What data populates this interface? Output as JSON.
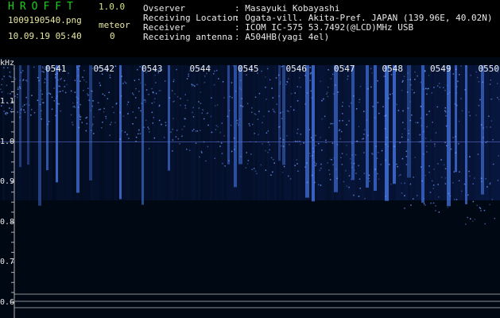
{
  "header": {
    "app_title": "HROFFT",
    "app_version": "1.0.0",
    "file_name": "1009190540.png",
    "meteor_label": "meteor",
    "timestamp": "10.09.19 05:40",
    "meteor_count": "0"
  },
  "meta": [
    {
      "label": "Ovserver",
      "value": ": Masayuki Kobayashi"
    },
    {
      "label": "Receiving Location",
      "value": ": Ogata-vill. Akita-Pref. JAPAN (139.96E, 40.02N)"
    },
    {
      "label": "Receiver",
      "value": ": ICOM IC-575 53.7492(@LCD)MHz USB"
    },
    {
      "label": "Receiving antenna",
      "value": ": A504HB(yagi 4el)"
    }
  ],
  "spectrogram": {
    "unit_label": "kHz",
    "y_ticks": [
      "1.1",
      "1.0",
      "0.9",
      "0.8",
      "0.7",
      "0.6"
    ],
    "y_values": [
      1.1,
      1.0,
      0.9,
      0.8,
      0.7,
      0.6
    ],
    "x_ticks": [
      "0541",
      "0542",
      "0543",
      "0544",
      "0545",
      "0546",
      "0547",
      "0548",
      "0549",
      "0550"
    ],
    "colors": {
      "background": "#000814",
      "signal": "#2a5cff",
      "grid": "#c8c8c8"
    }
  }
}
